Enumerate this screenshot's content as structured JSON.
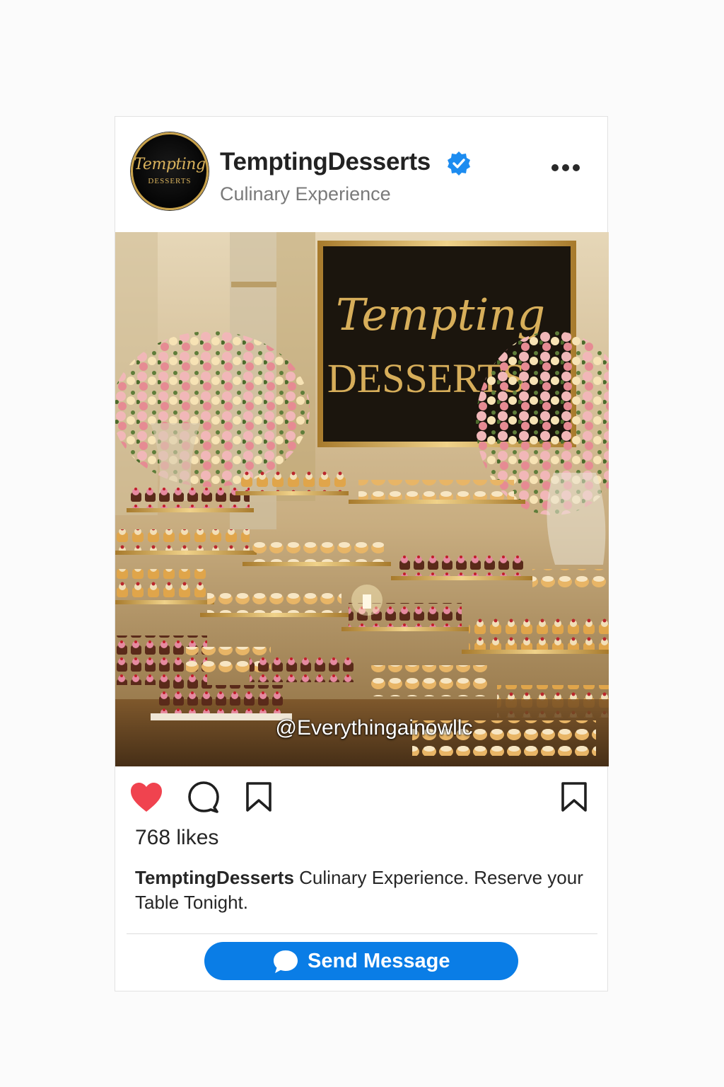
{
  "post": {
    "avatar": {
      "logo_script": "Tempting",
      "logo_caps": "DESSERTS"
    },
    "username": "TemptingDesserts",
    "subtitle": "Culinary Experience",
    "verified": true,
    "more_icon": "more-horizontal-icon",
    "image": {
      "sign_script": "Tempting",
      "sign_caps": "DESSERTS",
      "watermark": "@Everythingainowllc"
    },
    "actions": {
      "like_icon": "heart-filled-icon",
      "comment_icon": "comment-icon",
      "share_icon": "bookmark-outline-icon",
      "save_icon": "bookmark-icon"
    },
    "likes": "768 likes",
    "caption": {
      "author": "TemptingDesserts",
      "text": "Culinary Experience. Reserve your Table Tonight."
    },
    "cta": {
      "label": "Send Message",
      "icon": "chat-bubble-icon"
    }
  },
  "colors": {
    "accent_blue": "#0a7de6",
    "verified_blue": "#1d8cf0",
    "like_red": "#f0434f",
    "gold": "#d9b25c"
  }
}
